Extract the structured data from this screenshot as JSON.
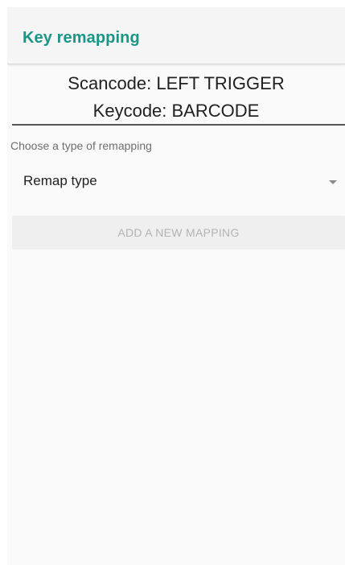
{
  "app_bar": {
    "title": "Key remapping"
  },
  "key_info": {
    "scancode": "Scancode: LEFT TRIGGER",
    "keycode": "Keycode: BARCODE"
  },
  "remap": {
    "label": "Choose a type of remapping",
    "spinner_value": "Remap type",
    "add_button_label": "ADD A NEW MAPPING"
  },
  "colors": {
    "accent": "#1a9686",
    "background": "#fafafa",
    "text_primary": "#212121",
    "button_disabled_bg": "#efefef",
    "button_disabled_text": "#b3b3b3"
  },
  "icons": {
    "spinner_arrow": "dropdown-arrow-icon"
  }
}
